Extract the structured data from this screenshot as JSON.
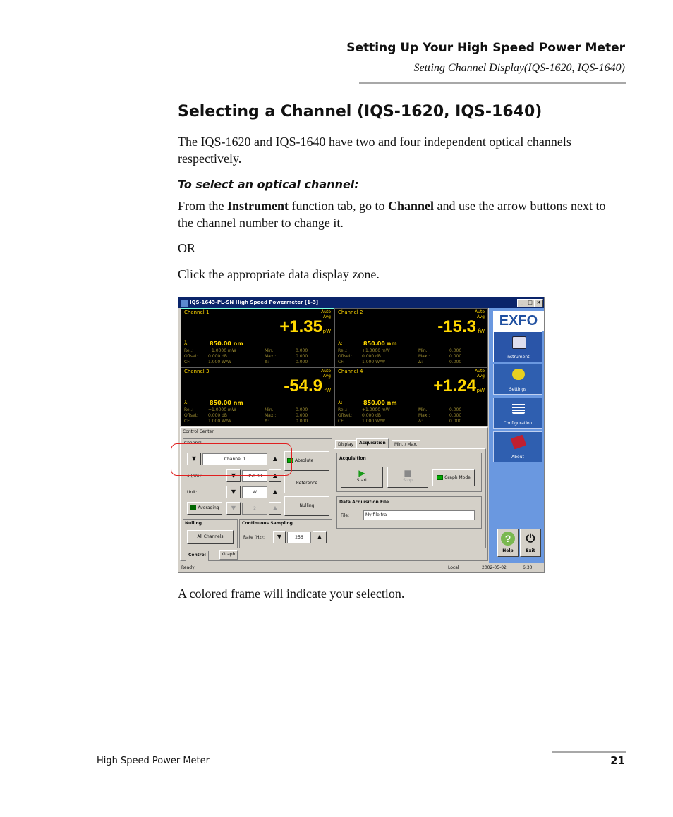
{
  "header": {
    "title": "Setting Up Your High Speed Power Meter",
    "subtitle": "Setting Channel Display(IQS-1620, IQS-1640)"
  },
  "section": {
    "heading": "Selecting a Channel (IQS-1620, IQS-1640)",
    "intro": "The IQS-1620 and IQS-1640 have two and four independent optical channels respectively.",
    "procedure_title": "To select an optical channel:",
    "step1_pre": "From the ",
    "step1_b1": "Instrument",
    "step1_mid": " function tab, go to ",
    "step1_b2": "Channel",
    "step1_post": " and use the arrow buttons next to the channel number to change it.",
    "or": "OR",
    "step2": "Click the appropriate data display zone.",
    "caption": "A colored frame will indicate your selection."
  },
  "footer": {
    "left": "High Speed Power Meter",
    "page": "21"
  },
  "app": {
    "title": "IQS-1643-PL-SN High Speed Powermeter [1-3]",
    "window_buttons": [
      "_",
      "□",
      "×"
    ],
    "channels": [
      {
        "name": "Channel 1",
        "mode1": "Auto",
        "mode2": "Avg",
        "value": "+1.35",
        "unit": "pW",
        "lambda_label": "λ:",
        "lambda": "850.00  nm",
        "rows": [
          [
            "Rel.:",
            "+1.0000  mW",
            "Min.:",
            "0.000"
          ],
          [
            "Offset:",
            "0.000  dB",
            "Max.:",
            "0.000"
          ],
          [
            "CF:",
            "1.000  W/W",
            "Δ:",
            "0.000"
          ]
        ]
      },
      {
        "name": "Channel 2",
        "mode1": "Auto",
        "mode2": "Avg",
        "value": "-15.3",
        "unit": "fW",
        "lambda_label": "λ:",
        "lambda": "850.00  nm",
        "rows": [
          [
            "Rel.:",
            "+1.0000  mW",
            "Min.:",
            "0.000"
          ],
          [
            "Offset:",
            "0.000  dB",
            "Max.:",
            "0.000"
          ],
          [
            "CF:",
            "1.000  W/W",
            "Δ:",
            "0.000"
          ]
        ]
      },
      {
        "name": "Channel 3",
        "mode1": "Auto",
        "mode2": "Avg",
        "value": "-54.9",
        "unit": "fW",
        "lambda_label": "λ:",
        "lambda": "850.00  nm",
        "rows": [
          [
            "Rel.:",
            "+1.0000  mW",
            "Min.:",
            "0.000"
          ],
          [
            "Offset:",
            "0.000  dB",
            "Max.:",
            "0.000"
          ],
          [
            "CF:",
            "1.000  W/W",
            "Δ:",
            "0.000"
          ]
        ]
      },
      {
        "name": "Channel 4",
        "mode1": "Auto",
        "mode2": "Avg",
        "value": "+1.24",
        "unit": "pW",
        "lambda_label": "λ:",
        "lambda": "850.00  nm",
        "rows": [
          [
            "Rel.:",
            "+1.0000  mW",
            "Min.:",
            "0.000"
          ],
          [
            "Offset:",
            "0.000  dB",
            "Max.:",
            "0.000"
          ],
          [
            "CF:",
            "1.000  W/W",
            "Δ:",
            "0.000"
          ]
        ]
      }
    ],
    "sidebar": {
      "logo": "EXFO",
      "instrument": "Instrument",
      "settings": "Settings",
      "configuration": "Configuration",
      "about": "About",
      "help": "Help",
      "exit": "Exit"
    },
    "control": {
      "title": "Control Center",
      "channel_group": "Channel",
      "channel_value": "Channel 1",
      "absolute": "Absolute",
      "lambda_label": "λ (nm):",
      "lambda_value": "850.00",
      "reference": "Reference",
      "unit_label": "Unit:",
      "unit_value": "W",
      "averaging": "Averaging",
      "avg_value": "2",
      "nulling_btn": "Nulling",
      "nulling_group": "Nulling",
      "all_channels": "All Channels",
      "continuous_group": "Continuous Sampling",
      "rate_label": "Rate (Hz):",
      "rate_value": "256",
      "tabs": [
        "Display",
        "Acquisition",
        "Min. / Max."
      ],
      "acq_group": "Acquisition",
      "start": "Start",
      "stop": "Stop",
      "graph_mode": "Graph Mode",
      "daf_group": "Data Acquisition File",
      "file_label": "File:",
      "file_value": "My file.tra",
      "bottom_tabs": [
        "Control",
        "Graph"
      ]
    },
    "status": {
      "ready": "Ready",
      "local": "Local",
      "date": "2002-05-02",
      "time": "6:30"
    }
  }
}
